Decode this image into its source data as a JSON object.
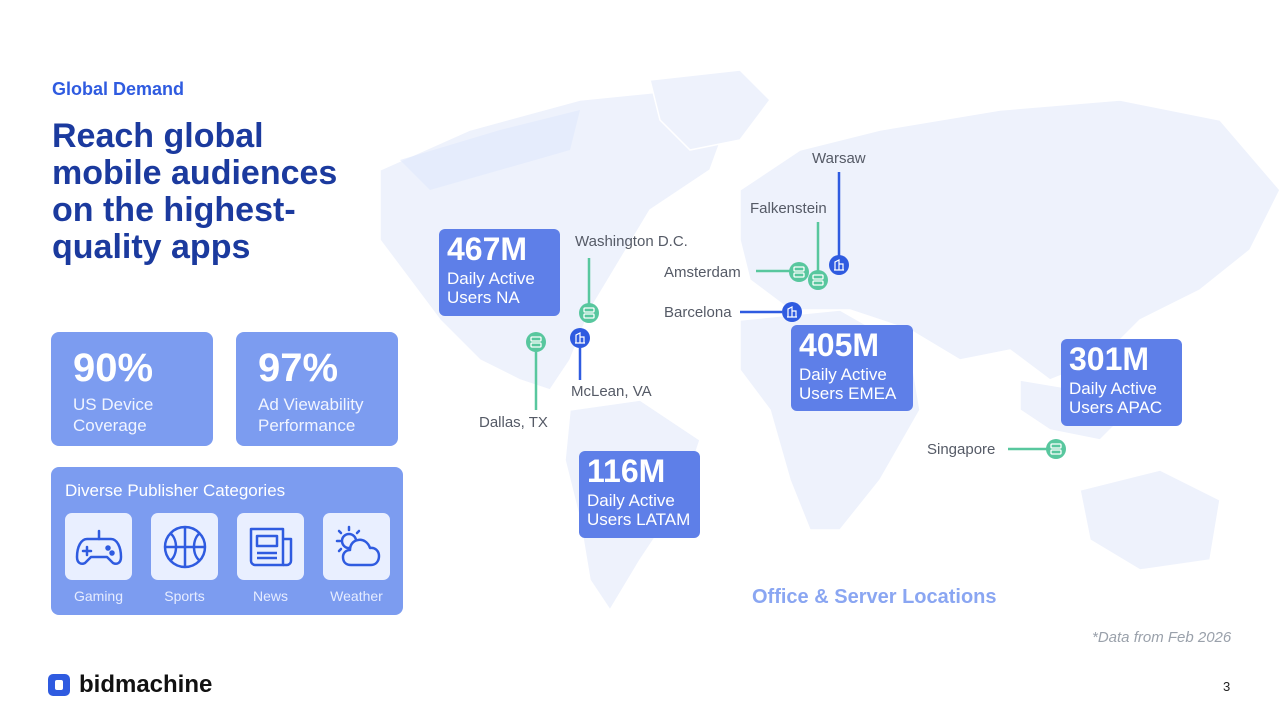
{
  "header": {
    "eyebrow": "Global Demand",
    "title": "Reach global\nmobile audiences\non the highest-\nquality apps"
  },
  "stats": [
    {
      "value": "90%",
      "label": "US Device\nCoverage"
    },
    {
      "value": "97%",
      "label": "Ad Viewability\nPerformance"
    }
  ],
  "categories": {
    "title": "Diverse Publisher Categories",
    "items": [
      {
        "label": "Gaming",
        "icon": "gamepad-icon"
      },
      {
        "label": "Sports",
        "icon": "basketball-icon"
      },
      {
        "label": "News",
        "icon": "newspaper-icon"
      },
      {
        "label": "Weather",
        "icon": "weather-icon"
      }
    ]
  },
  "regions": [
    {
      "value": "467M",
      "label": "Daily Active\nUsers NA"
    },
    {
      "value": "405M",
      "label": "Daily Active\nUsers EMEA"
    },
    {
      "value": "301M",
      "label": "Daily Active\nUsers APAC"
    },
    {
      "value": "116M",
      "label": "Daily Active\nUsers LATAM"
    }
  ],
  "locations": [
    {
      "name": "Washington D.C.",
      "type": "server"
    },
    {
      "name": "McLean, VA",
      "type": "office"
    },
    {
      "name": "Dallas, TX",
      "type": "server"
    },
    {
      "name": "Warsaw",
      "type": "office"
    },
    {
      "name": "Falkenstein",
      "type": "server"
    },
    {
      "name": "Amsterdam",
      "type": "server"
    },
    {
      "name": "Barcelona",
      "type": "office"
    },
    {
      "name": "Singapore",
      "type": "server"
    }
  ],
  "legend": "Office & Server Locations",
  "footnote": "*Data from Feb 2026",
  "brand": "bidmachine",
  "page_number": "3",
  "colors": {
    "accent": "#2f5be0",
    "server": "#58c79e",
    "panel": "#7c9cf0",
    "region": "#5e7fe8",
    "title": "#1b3a9e"
  }
}
